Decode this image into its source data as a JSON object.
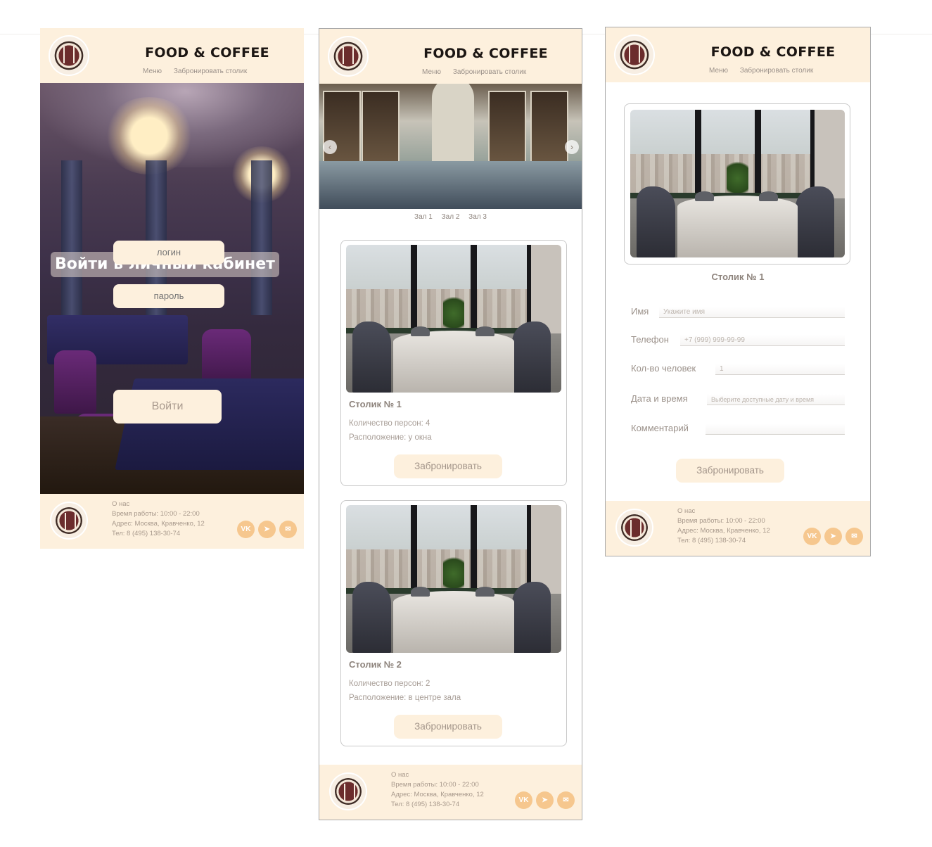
{
  "brand": "FOOD & COFFEE",
  "nav": {
    "menu": "Меню",
    "book": "Забронировать столик"
  },
  "footer": {
    "about": "О нас",
    "hours": "Время работы: 10:00 - 22:00",
    "address": "Адрес: Москва,  Кравченко, 12",
    "phone": "Тел: 8 (495) 138-30-74",
    "socials": [
      "vk-icon",
      "telegram-icon",
      "mail-icon"
    ]
  },
  "login": {
    "title": "Войти в личный кабинет",
    "login_placeholder": "логин",
    "password_placeholder": "пароль",
    "submit": "Войти"
  },
  "halls": [
    "Зал 1",
    "Зал 2",
    "Зал 3"
  ],
  "tables": [
    {
      "title": "Столик № 1",
      "persons": "Количество персон: 4",
      "location": "Расположение: у окна",
      "button": "Забронировать"
    },
    {
      "title": "Столик № 2",
      "persons": "Количество персон: 2",
      "location": "Расположение: в центре зала",
      "button": "Забронировать"
    }
  ],
  "booking": {
    "title": "Столик № 1",
    "fields": [
      {
        "label": "Имя",
        "placeholder": "Укажите имя"
      },
      {
        "label": "Телефон",
        "placeholder": "+7 (999) 999-99-99"
      },
      {
        "label": "Кол-во человек",
        "placeholder": "1"
      },
      {
        "label": "Дата и время",
        "placeholder": "Выберите доступные дату и время"
      },
      {
        "label": "Комментарий",
        "placeholder": ""
      }
    ],
    "submit": "Забронировать"
  },
  "colors": {
    "cream": "#fdf0dd",
    "accent": "#f6c78e",
    "text_muted": "#a79d96"
  }
}
